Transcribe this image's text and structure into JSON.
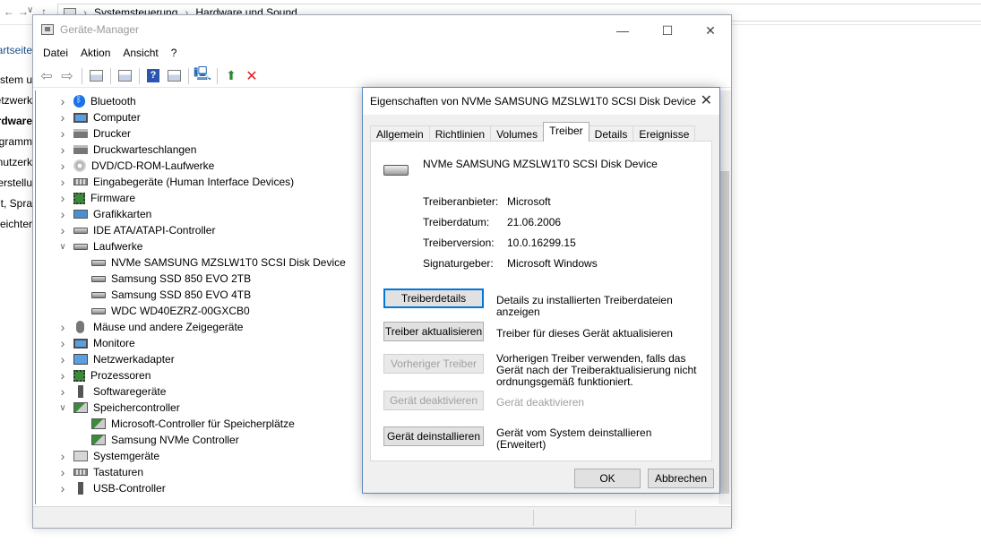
{
  "background": {
    "breadcrumb": [
      "Systemsteuerung",
      "Hardware und Sound"
    ],
    "nav_back": "←",
    "nav_forward": "→",
    "nav_dropdown": "∨",
    "nav_up": "↑",
    "left_items": [
      "artseite",
      "stem u",
      "etzwerk",
      "ardware",
      "ogramm",
      "nutzerk",
      "erstellu",
      "it, Spra",
      "eichter"
    ]
  },
  "device_manager": {
    "title": "Geräte-Manager",
    "menu": [
      "Datei",
      "Aktion",
      "Ansicht",
      "?"
    ],
    "tree": [
      {
        "label": "Bluetooth",
        "icon": "bluetooth-icon",
        "level": 0,
        "expanded": false
      },
      {
        "label": "Computer",
        "icon": "computer-icon",
        "level": 0,
        "expanded": false
      },
      {
        "label": "Drucker",
        "icon": "printer-icon",
        "level": 0,
        "expanded": false
      },
      {
        "label": "Druckwarteschlangen",
        "icon": "printer-icon",
        "level": 0,
        "expanded": false
      },
      {
        "label": "DVD/CD-ROM-Laufwerke",
        "icon": "disc-icon",
        "level": 0,
        "expanded": false
      },
      {
        "label": "Eingabegeräte (Human Interface Devices)",
        "icon": "keyboard-icon",
        "level": 0,
        "expanded": false
      },
      {
        "label": "Firmware",
        "icon": "chip-icon",
        "level": 0,
        "expanded": false
      },
      {
        "label": "Grafikkarten",
        "icon": "gpu-icon",
        "level": 0,
        "expanded": false
      },
      {
        "label": "IDE ATA/ATAPI-Controller",
        "icon": "drive-icon",
        "level": 0,
        "expanded": false
      },
      {
        "label": "Laufwerke",
        "icon": "drive-icon",
        "level": 0,
        "expanded": true
      },
      {
        "label": "NVMe SAMSUNG MZSLW1T0 SCSI Disk Device",
        "icon": "drive-icon",
        "level": 1
      },
      {
        "label": "Samsung SSD 850 EVO 2TB",
        "icon": "drive-icon",
        "level": 1
      },
      {
        "label": "Samsung SSD 850 EVO 4TB",
        "icon": "drive-icon",
        "level": 1
      },
      {
        "label": "WDC WD40EZRZ-00GXCB0",
        "icon": "drive-icon",
        "level": 1
      },
      {
        "label": "Mäuse und andere Zeigegeräte",
        "icon": "mouse-icon",
        "level": 0,
        "expanded": false
      },
      {
        "label": "Monitore",
        "icon": "monitor-icon",
        "level": 0,
        "expanded": false
      },
      {
        "label": "Netzwerkadapter",
        "icon": "network-icon",
        "level": 0,
        "expanded": false
      },
      {
        "label": "Prozessoren",
        "icon": "chip-icon",
        "level": 0,
        "expanded": false
      },
      {
        "label": "Softwaregeräte",
        "icon": "usb-icon",
        "level": 0,
        "expanded": false
      },
      {
        "label": "Speichercontroller",
        "icon": "storage-icon",
        "level": 0,
        "expanded": true
      },
      {
        "label": "Microsoft-Controller für Speicherplätze",
        "icon": "storage-icon",
        "level": 1
      },
      {
        "label": "Samsung NVMe Controller",
        "icon": "storage-icon",
        "level": 1
      },
      {
        "label": "Systemgeräte",
        "icon": "system-icon",
        "level": 0,
        "expanded": false
      },
      {
        "label": "Tastaturen",
        "icon": "keyboard-icon",
        "level": 0,
        "expanded": false
      },
      {
        "label": "USB-Controller",
        "icon": "usb-icon",
        "level": 0,
        "expanded": false
      }
    ]
  },
  "dialog": {
    "title": "Eigenschaften von NVMe SAMSUNG MZSLW1T0 SCSI Disk Device",
    "tabs": [
      "Allgemein",
      "Richtlinien",
      "Volumes",
      "Treiber",
      "Details",
      "Ereignisse"
    ],
    "active_tab": "Treiber",
    "device_name": "NVMe SAMSUNG MZSLW1T0 SCSI Disk Device",
    "info": {
      "provider_label": "Treiberanbieter:",
      "provider": "Microsoft",
      "date_label": "Treiberdatum:",
      "date": "21.06.2006",
      "version_label": "Treiberversion:",
      "version": "10.0.16299.15",
      "signer_label": "Signaturgeber:",
      "signer": "Microsoft Windows"
    },
    "actions": [
      {
        "label": "Treiberdetails",
        "desc": "Details zu installierten Treiberdateien anzeigen",
        "enabled": true
      },
      {
        "label": "Treiber aktualisieren",
        "desc": "Treiber für dieses Gerät aktualisieren",
        "enabled": true
      },
      {
        "label": "Vorheriger Treiber",
        "desc": "Vorherigen Treiber verwenden, falls das Gerät nach der Treiberaktualisierung nicht ordnungsgemäß funktioniert.",
        "enabled": false
      },
      {
        "label": "Gerät deaktivieren",
        "desc": "Gerät deaktivieren",
        "enabled": false
      },
      {
        "label": "Gerät deinstallieren",
        "desc": "Gerät vom System deinstallieren (Erweitert)",
        "enabled": true
      }
    ],
    "ok": "OK",
    "cancel": "Abbrechen"
  }
}
